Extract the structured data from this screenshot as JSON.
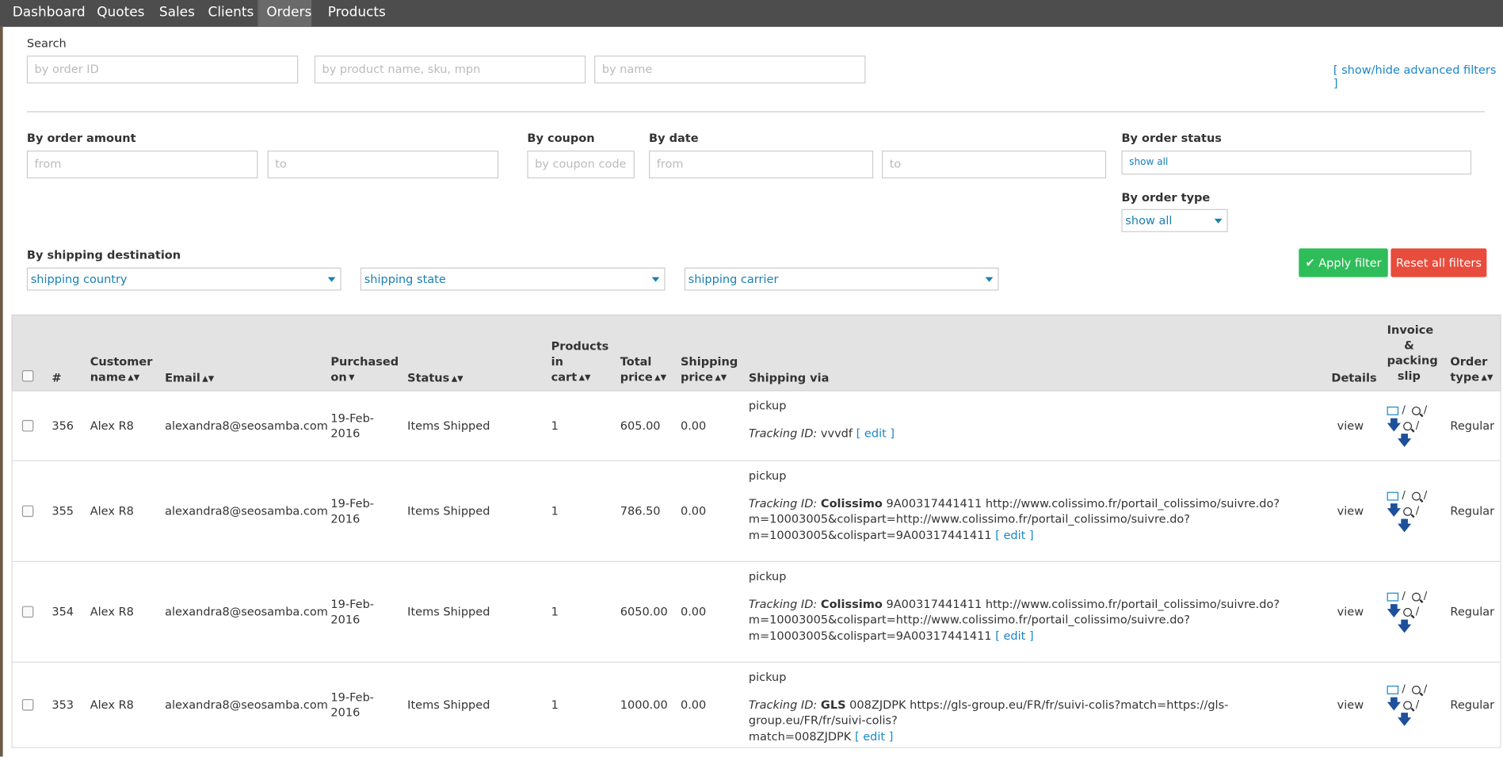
{
  "nav": {
    "items": [
      "Dashboard",
      "Quotes",
      "Sales",
      "Clients",
      "Orders",
      "Products"
    ],
    "active": "Orders"
  },
  "search": {
    "label": "Search",
    "order_id_placeholder": "by order ID",
    "product_placeholder": "by product name, sku, mpn",
    "name_placeholder": "by name",
    "advanced_link": "[ show/hide advanced filters ]"
  },
  "filters": {
    "amount_label": "By order amount",
    "amount_from": "from",
    "amount_to": "to",
    "coupon_label": "By coupon",
    "coupon_placeholder": "by coupon code",
    "date_label": "By date",
    "date_from": "from",
    "date_to": "to",
    "status_label": "By order status",
    "status_value": "show all",
    "type_label": "By order type",
    "type_value": "show all",
    "shipping_label": "By shipping destination",
    "country_value": "shipping country",
    "state_value": "shipping state",
    "carrier_value": "shipping carrier",
    "apply_label": "Apply filter",
    "reset_label": "Reset all filters"
  },
  "table": {
    "headers": {
      "num": "#",
      "customer_1": "Customer",
      "customer_2": "name",
      "email": "Email",
      "purchased_1": "Purchased",
      "purchased_2": "on",
      "status": "Status",
      "products_1": "Products",
      "products_2": "in",
      "products_3": "cart",
      "total_1": "Total",
      "total_2": "price",
      "shipping_price_1": "Shipping",
      "shipping_price_2": "price",
      "shipping_via": "Shipping via",
      "details": "Details",
      "invoice_1": "Invoice",
      "invoice_2": "&",
      "invoice_3": "packing",
      "invoice_4": "slip",
      "type_1": "Order",
      "type_2": "type"
    },
    "rows": [
      {
        "id": "356",
        "customer": "Alex R8",
        "email": "alexandra8@seosamba.com",
        "date_1": "19-Feb-",
        "date_2": "2016",
        "status": "Items Shipped",
        "products": "1",
        "total": "605.00",
        "shipping": "0.00",
        "via": "pickup",
        "tracking_label": "Tracking ID:",
        "carrier": "",
        "tracking_1": "vvvdf",
        "tracking_2": "",
        "tracking_3": "",
        "edit": "[ edit ]",
        "details": "view",
        "type": "Regular"
      },
      {
        "id": "355",
        "customer": "Alex R8",
        "email": "alexandra8@seosamba.com",
        "date_1": "19-Feb-",
        "date_2": "2016",
        "status": "Items Shipped",
        "products": "1",
        "total": "786.50",
        "shipping": "0.00",
        "via": "pickup",
        "tracking_label": "Tracking ID:",
        "carrier": "Colissimo",
        "tracking_1": "9A00317441411 http://www.colissimo.fr/portail_colissimo/suivre.do?",
        "tracking_2": "m=10003005&colispart=http://www.colissimo.fr/portail_colissimo/suivre.do?",
        "tracking_3": "m=10003005&colispart=9A00317441411",
        "edit": "[ edit ]",
        "details": "view",
        "type": "Regular"
      },
      {
        "id": "354",
        "customer": "Alex R8",
        "email": "alexandra8@seosamba.com",
        "date_1": "19-Feb-",
        "date_2": "2016",
        "status": "Items Shipped",
        "products": "1",
        "total": "6050.00",
        "shipping": "0.00",
        "via": "pickup",
        "tracking_label": "Tracking ID:",
        "carrier": "Colissimo",
        "tracking_1": "9A00317441411 http://www.colissimo.fr/portail_colissimo/suivre.do?",
        "tracking_2": "m=10003005&colispart=http://www.colissimo.fr/portail_colissimo/suivre.do?",
        "tracking_3": "m=10003005&colispart=9A00317441411",
        "edit": "[ edit ]",
        "details": "view",
        "type": "Regular"
      },
      {
        "id": "353",
        "customer": "Alex R8",
        "email": "alexandra8@seosamba.com",
        "date_1": "19-Feb-",
        "date_2": "2016",
        "status": "Items Shipped",
        "products": "1",
        "total": "1000.00",
        "shipping": "0.00",
        "via": "pickup",
        "tracking_label": "Tracking ID:",
        "carrier": "GLS",
        "tracking_1": "008ZJDPK https://gls-group.eu/FR/fr/suivi-colis?match=https://gls-group.eu/FR/fr/suivi-colis?",
        "tracking_2": "match=008ZJDPK",
        "tracking_3": "",
        "edit": "[ edit ]",
        "details": "view",
        "type": "Regular"
      }
    ]
  },
  "colors": {
    "nav_bg": "#4d4d4d",
    "link": "#1a87c9",
    "apply": "#2ebd59",
    "reset": "#e74c3c",
    "download_icon": "#1e4f9a"
  }
}
